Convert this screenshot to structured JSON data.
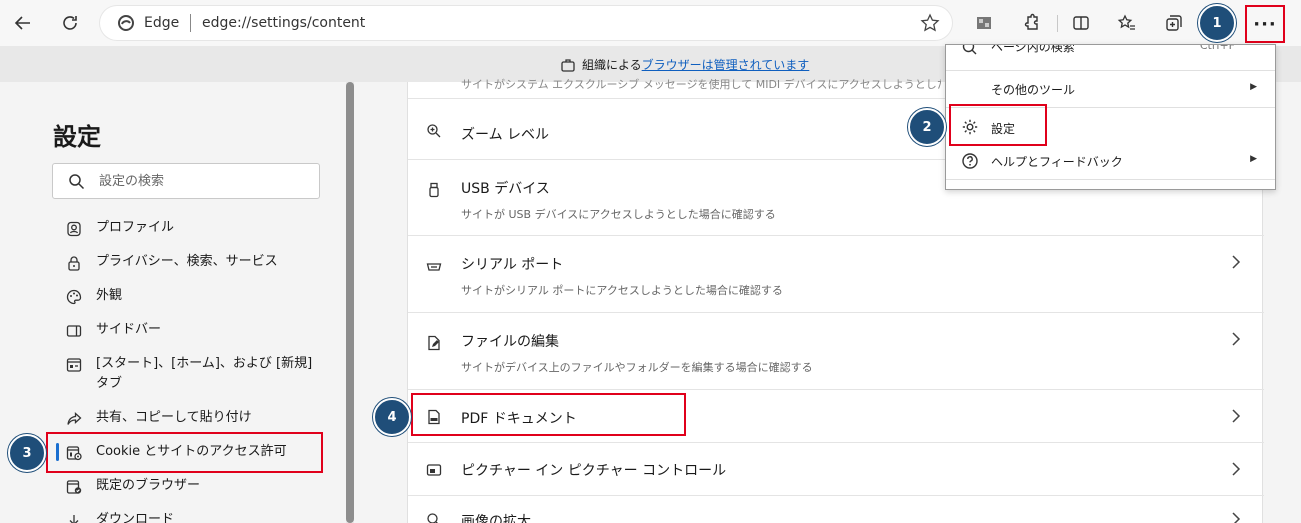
{
  "browser": {
    "site_name": "Edge",
    "url": "edge://settings/content"
  },
  "managed_bar": {
    "prefix": "組織による",
    "link": "ブラウザーは管理されています"
  },
  "sidebar": {
    "title": "設定",
    "search_placeholder": "設定の検索",
    "items": [
      {
        "label": "プロファイル",
        "icon": "profile-icon"
      },
      {
        "label": "プライバシー、検索、サービス",
        "icon": "lock-icon"
      },
      {
        "label": "外観",
        "icon": "palette-icon"
      },
      {
        "label": "サイドバー",
        "icon": "sidebar-icon"
      },
      {
        "label": "[スタート]、[ホーム]、および [新規] タブ",
        "icon": "home-tabs-icon"
      },
      {
        "label": "共有、コピーして貼り付け",
        "icon": "share-icon"
      },
      {
        "label": "Cookie とサイトのアクセス許可",
        "icon": "cookie-permissions-icon",
        "active": true
      },
      {
        "label": "既定のブラウザー",
        "icon": "default-browser-icon"
      },
      {
        "label": "ダウンロード",
        "icon": "download-icon"
      }
    ]
  },
  "content": {
    "cut_description": "サイトがシステム エクスクルーシブ メッセージを使用して MIDI デバイスにアクセスしようとした場合に確認する",
    "rows": [
      {
        "title": "ズーム レベル",
        "description": "",
        "icon": "zoom-icon"
      },
      {
        "title": "USB デバイス",
        "description": "サイトが USB デバイスにアクセスしようとした場合に確認する",
        "icon": "usb-icon"
      },
      {
        "title": "シリアル ポート",
        "description": "サイトがシリアル ポートにアクセスしようとした場合に確認する",
        "icon": "serial-port-icon"
      },
      {
        "title": "ファイルの編集",
        "description": "サイトがデバイス上のファイルやフォルダーを編集する場合に確認する",
        "icon": "file-edit-icon"
      },
      {
        "title": "PDF ドキュメント",
        "description": "",
        "icon": "pdf-icon"
      },
      {
        "title": "ピクチャー イン ピクチャー コントロール",
        "description": "",
        "icon": "pip-icon"
      },
      {
        "title": "画像の拡大",
        "description": "",
        "icon": "image-zoom-icon"
      }
    ]
  },
  "menu": {
    "items": [
      {
        "label": "ページ内の検索",
        "shortcut": "Ctrl+F",
        "icon": "find-icon"
      },
      {
        "label": "その他のツール",
        "has_submenu": true
      },
      {
        "label": "設定",
        "icon": "gear-icon"
      },
      {
        "label": "ヘルプとフィードバック",
        "icon": "help-icon",
        "has_submenu": true
      }
    ]
  },
  "callouts": [
    "1",
    "2",
    "3",
    "4"
  ],
  "colors": {
    "highlight": "#e0001b",
    "badge": "#1f4e79",
    "link": "#0f5fbf",
    "active_indicator": "#1b6fd0"
  }
}
